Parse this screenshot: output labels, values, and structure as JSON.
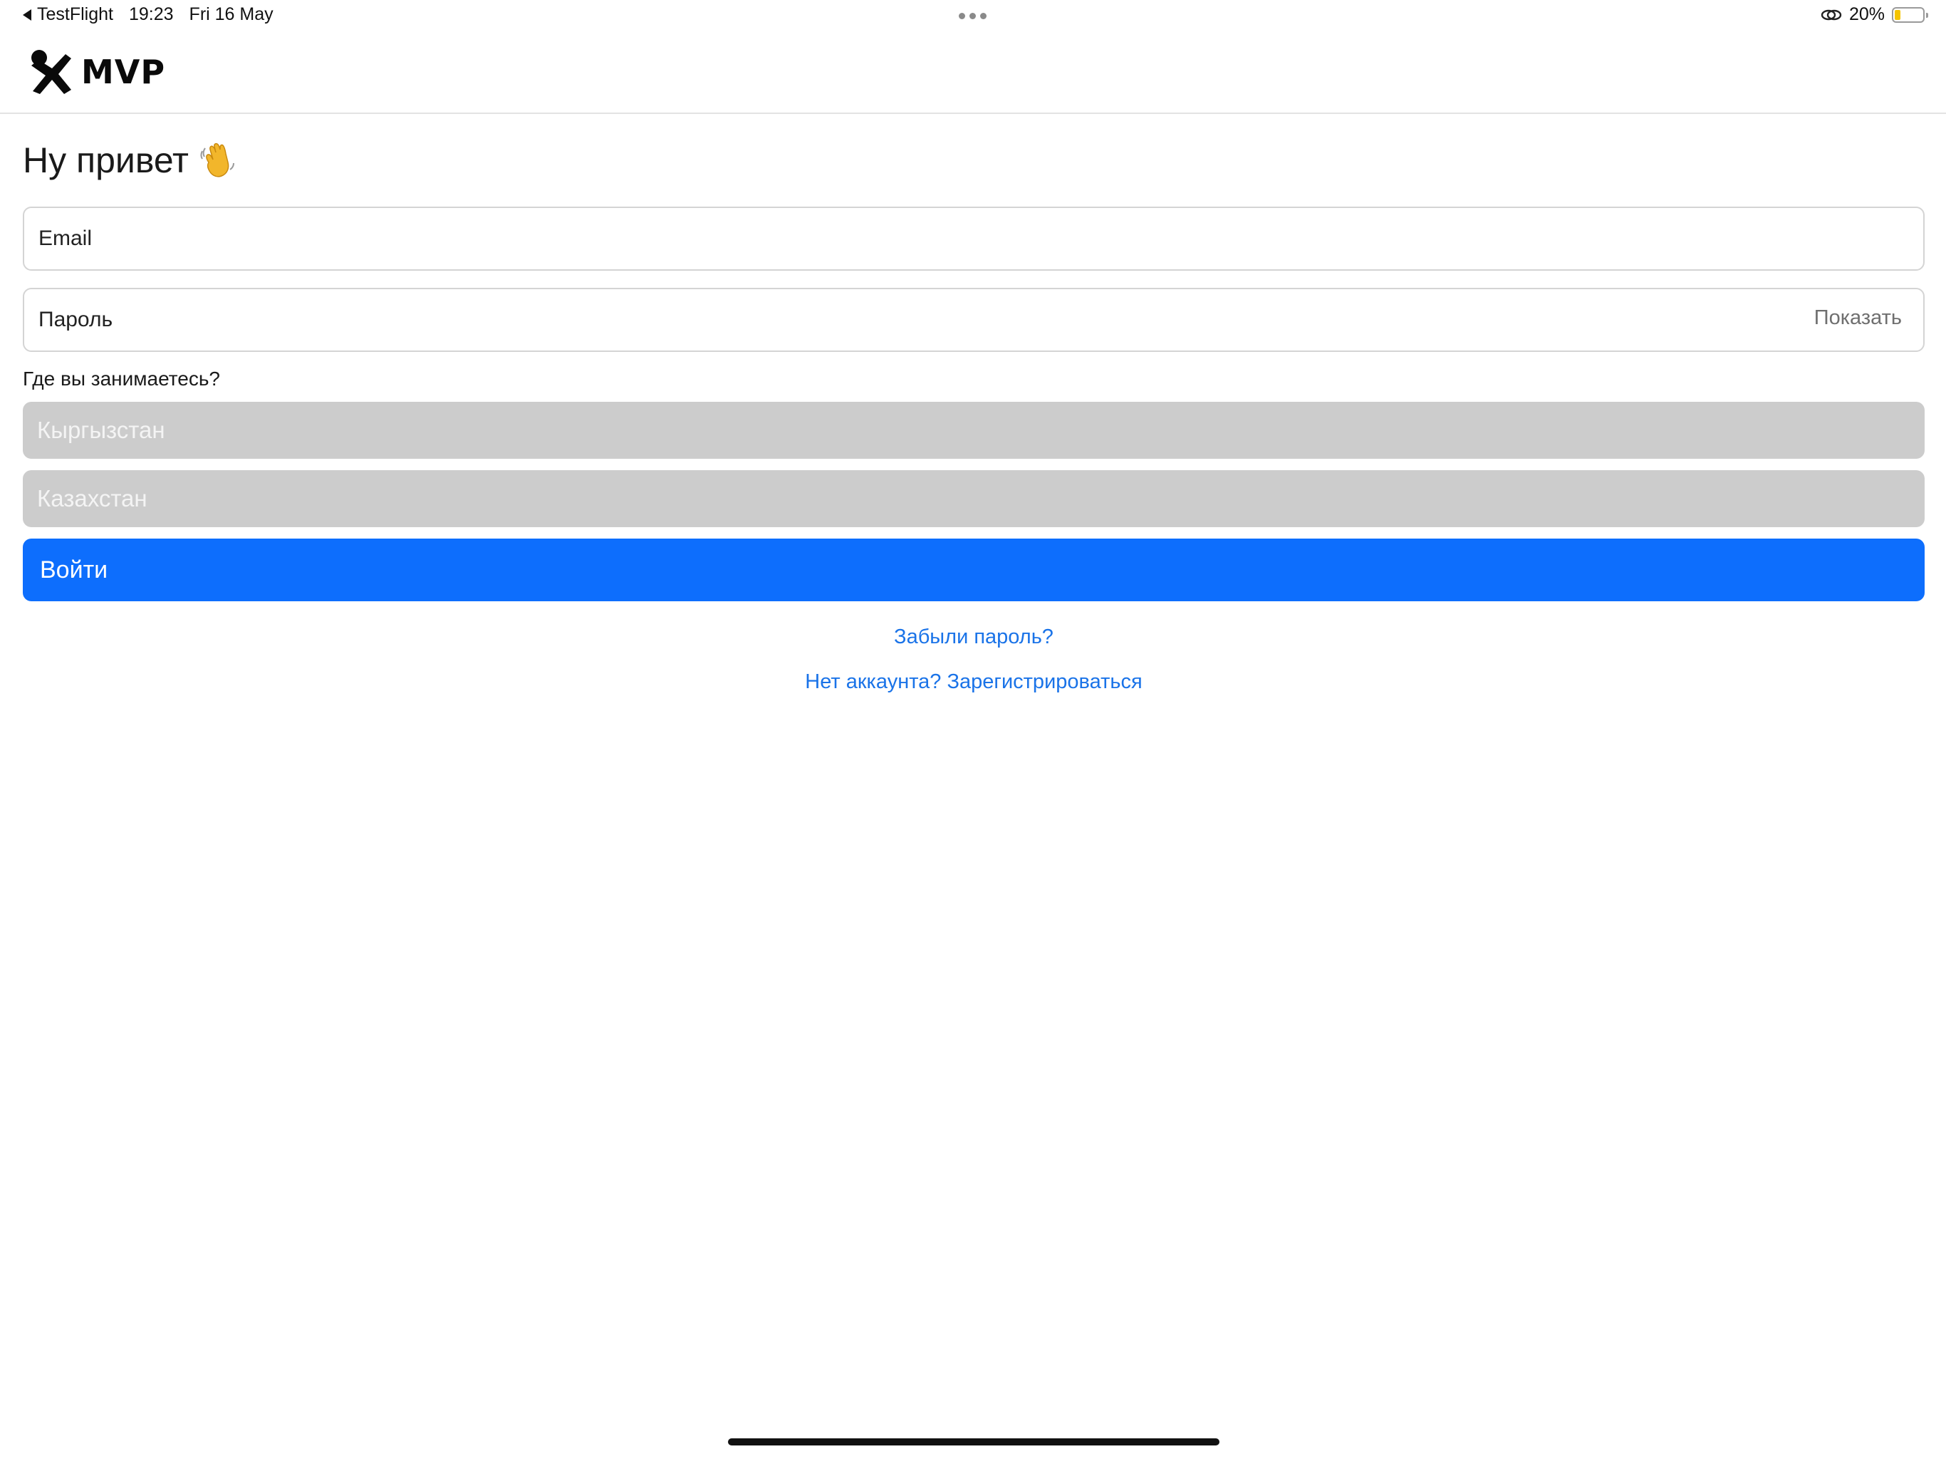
{
  "status_bar": {
    "back_app": "TestFlight",
    "time": "19:23",
    "date": "Fri 16 May",
    "battery_percent_label": "20%",
    "battery_level": 0.2,
    "battery_color": "#f5c400"
  },
  "header": {
    "logo_text": "MVP"
  },
  "login": {
    "greeting": "Ну привет",
    "greeting_icon": "waving-hand-icon",
    "email_placeholder": "Email",
    "password_placeholder": "Пароль",
    "show_password_label": "Показать",
    "location_question": "Где вы занимаетесь?",
    "countries": [
      "Кыргызстан",
      "Казахстан"
    ],
    "submit_label": "Войти",
    "forgot_password_link": "Забыли пароль?",
    "register_link": "Нет аккаунта? Зарегистрироваться"
  },
  "colors": {
    "primary": "#0d6efd",
    "link": "#1a73e8",
    "option_bg": "#cccccc"
  }
}
